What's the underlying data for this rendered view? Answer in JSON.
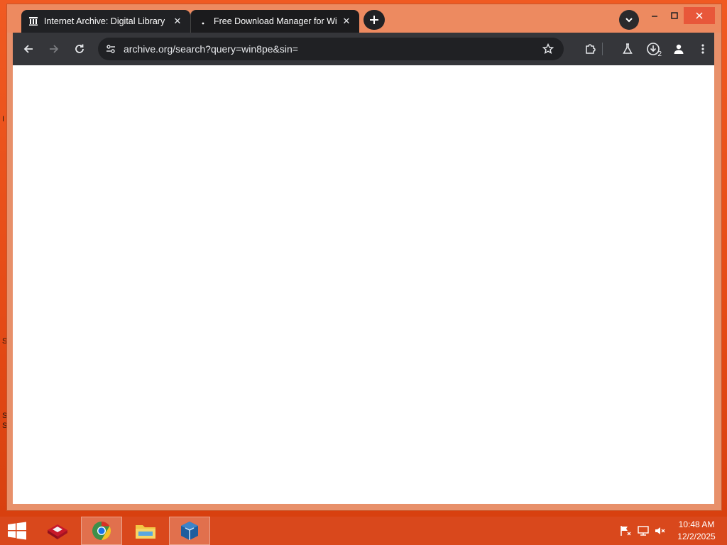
{
  "browser": {
    "tabs": [
      {
        "title": "Internet Archive: Digital Library",
        "favicon": "archive-building-icon",
        "active": true
      },
      {
        "title": "Free Download Manager for Wi",
        "favicon": "dot-icon",
        "active": false
      }
    ],
    "address_bar": {
      "url": "archive.org/search?query=win8pe&sin="
    },
    "downloads_count": "2"
  },
  "taskbar": {
    "apps": [
      "app-red-icon",
      "chrome-icon",
      "file-explorer-icon",
      "virtualbox-icon"
    ],
    "clock": {
      "time": "10:48 AM",
      "date": "12/2/2025"
    }
  },
  "desktop": {
    "edge_glyphs": [
      "I",
      "S",
      "S",
      "S"
    ]
  },
  "colors": {
    "desktop": "#e8501e",
    "titlebar": "#ed8a60",
    "toolbar": "#35363a",
    "taskbar": "#d9481c"
  }
}
